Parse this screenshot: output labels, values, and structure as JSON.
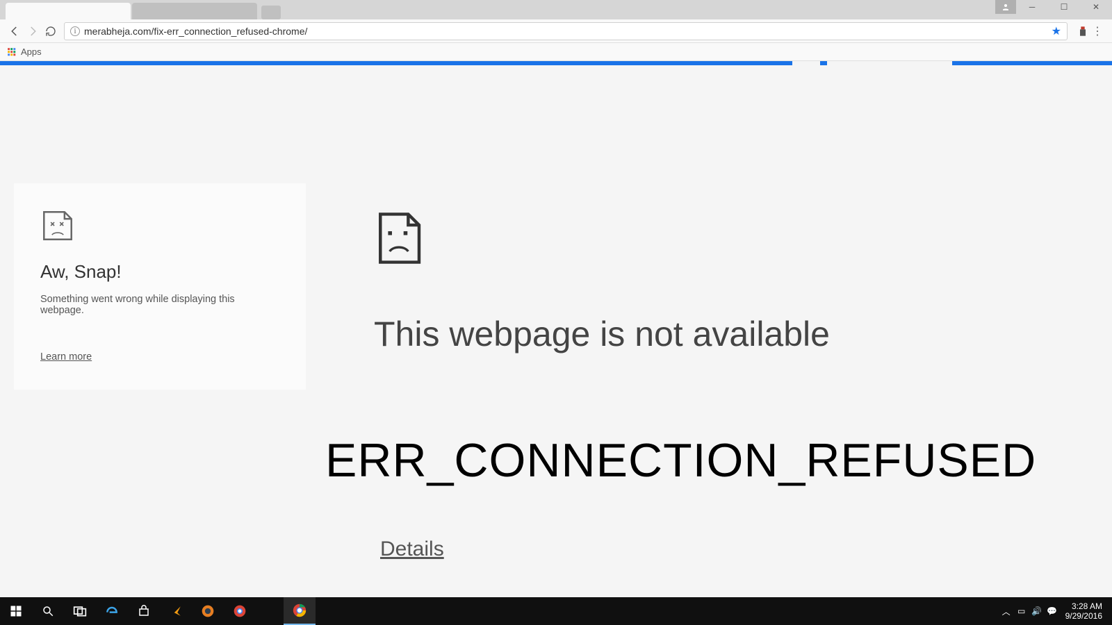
{
  "browser": {
    "url": "merabheja.com/fix-err_connection_refused-chrome/",
    "bookmarks_bar": {
      "apps_label": "Apps"
    }
  },
  "snap_card": {
    "title": "Aw, Snap!",
    "message": "Something went wrong while displaying this webpage.",
    "learn_more": "Learn more"
  },
  "main_error": {
    "heading": "This webpage is not available",
    "code": "ERR_CONNECTION_REFUSED",
    "details": "Details"
  },
  "taskbar": {
    "time": "3:28 AM",
    "date": "9/29/2016"
  }
}
